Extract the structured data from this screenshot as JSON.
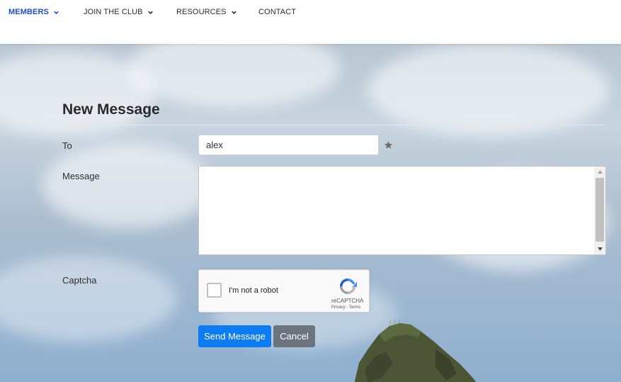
{
  "nav": {
    "items": [
      {
        "label": "MEMBERS",
        "active": true,
        "has_dropdown": true
      },
      {
        "label": "JOIN THE CLUB",
        "active": false,
        "has_dropdown": true
      },
      {
        "label": "RESOURCES",
        "active": false,
        "has_dropdown": true
      },
      {
        "label": "CONTACT",
        "active": false,
        "has_dropdown": false
      }
    ],
    "active_color": "#1c4fc8"
  },
  "form": {
    "title": "New Message",
    "to_label": "To",
    "to_value": "alex",
    "message_label": "Message",
    "message_value": "",
    "captcha_label": "Captcha"
  },
  "recaptcha": {
    "checkbox_label": "I'm not a robot",
    "brand": "reCAPTCHA",
    "links": "Privacy - Terms"
  },
  "buttons": {
    "send_label": "Send Message",
    "cancel_label": "Cancel",
    "send_color": "#0d7cf2",
    "cancel_color": "#6c757d"
  },
  "icons": {
    "favorite": "star-icon",
    "dropdown": "chevron-down-icon"
  }
}
